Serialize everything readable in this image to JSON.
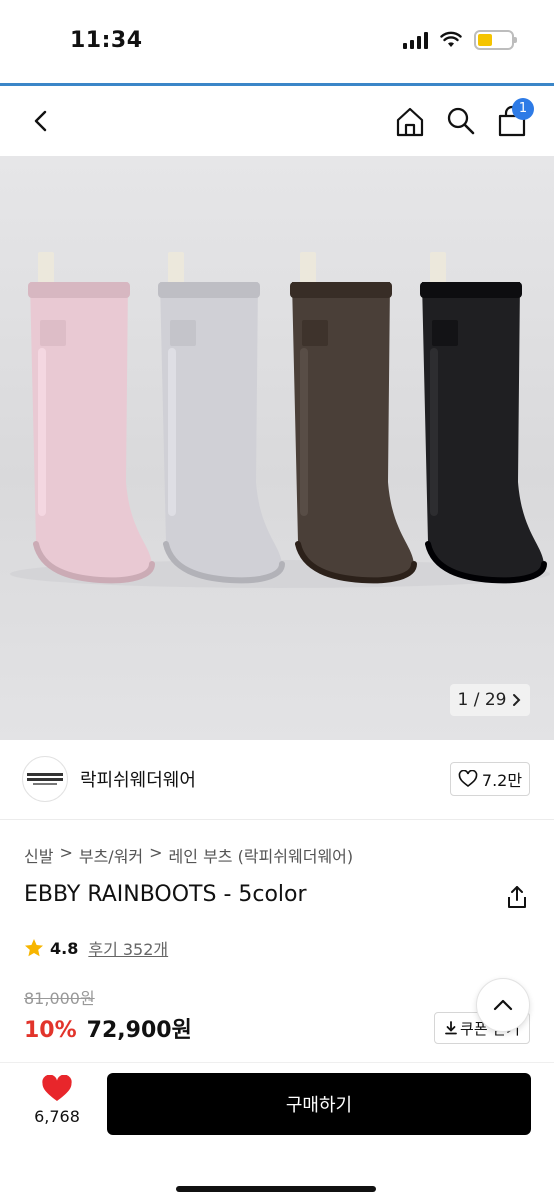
{
  "status_bar": {
    "time": "11:34",
    "battery_level": 0.45
  },
  "nav": {
    "cart_badge": "1"
  },
  "hero": {
    "image_counter": "1 / 29",
    "boot_colors": [
      "#e9c9d3",
      "#d0d0d6",
      "#4a3f38",
      "#1f1f22"
    ]
  },
  "brand": {
    "name": "락피쉬웨더웨어",
    "likes": "7.2만"
  },
  "breadcrumb": {
    "items": [
      "신발",
      "부츠/워커",
      "레인 부츠 (락피쉬웨더웨어)"
    ],
    "separator": ">"
  },
  "product": {
    "title": "EBBY RAINBOOTS - 5color",
    "rating": "4.8",
    "review_label": "후기 352개",
    "original_price": "81,000원",
    "discount": "10%",
    "price": "72,900원",
    "coupon_label": "쿠폰 받기"
  },
  "bottom": {
    "wish_count": "6,768",
    "buy_label": "구매하기"
  },
  "colors": {
    "accent": "#3b86c8",
    "discount_red": "#e2342b",
    "heart_red": "#e8262b",
    "badge_blue": "#2e7be6"
  }
}
